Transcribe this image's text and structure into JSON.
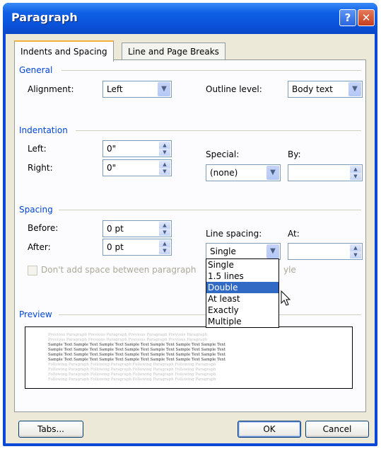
{
  "window": {
    "title": "Paragraph",
    "help_glyph": "?",
    "close_glyph": "✕"
  },
  "tabs": [
    "Indents and Spacing",
    "Line and Page Breaks"
  ],
  "general": {
    "heading": "General",
    "alignment_label": "Alignment:",
    "alignment_value": "Left",
    "outline_label": "Outline level:",
    "outline_value": "Body text"
  },
  "indentation": {
    "heading": "Indentation",
    "left_label": "Left:",
    "left_value": "0\"",
    "right_label": "Right:",
    "right_value": "0\"",
    "special_label": "Special:",
    "special_value": "(none)",
    "by_label": "By:",
    "by_value": ""
  },
  "spacing": {
    "heading": "Spacing",
    "before_label": "Before:",
    "before_value": "0 pt",
    "after_label": "After:",
    "after_value": "0 pt",
    "line_spacing_label": "Line spacing:",
    "line_spacing_value": "Single",
    "at_label": "At:",
    "at_value": "",
    "checkbox_label": "Don't add space between paragraphs of the same style",
    "checkbox_label_left": "Don't add space between paragraph",
    "checkbox_label_right": "yle"
  },
  "line_spacing_options": [
    "Single",
    "1.5 lines",
    "Double",
    "At least",
    "Exactly",
    "Multiple"
  ],
  "line_spacing_highlighted": "Double",
  "preview": {
    "heading": "Preview",
    "previous_text": "Previous Paragraph Previous Paragraph Previous Paragraph Previous Paragraph",
    "sample_text": "Sample Text Sample Text Sample Text Sample Text Sample Text Sample Text Sample Text",
    "following_text": "Following Paragraph Following Paragraph Following Paragraph Following Paragraph"
  },
  "buttons": {
    "tabs": "Tabs...",
    "ok": "OK",
    "cancel": "Cancel"
  },
  "colors": {
    "title_bar": "#0a52da",
    "group_heading": "#0046d5",
    "selection": "#316ac5",
    "dialog_bg": "#ece9d8"
  },
  "icons": {
    "dropdown": "chevron-down-icon",
    "spinner": "spinner-arrows-icon",
    "cursor": "mouse-pointer-icon"
  }
}
